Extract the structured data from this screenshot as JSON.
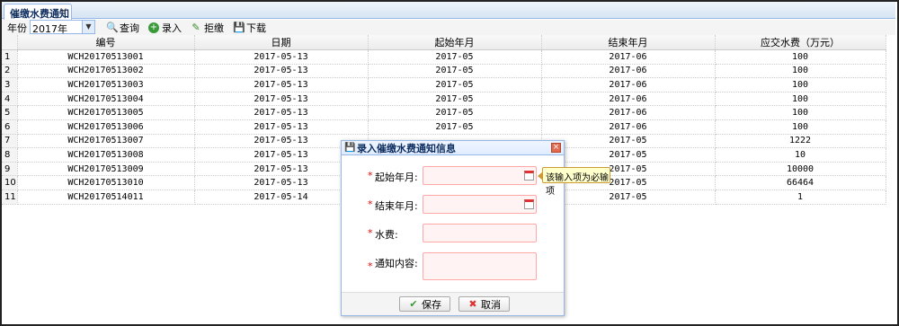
{
  "tab": {
    "title": "催缴水费通知",
    "close": "×"
  },
  "toolbar": {
    "year_label": "年份",
    "year_value": "2017年",
    "query_label": "查询",
    "add_label": "录入",
    "reject_label": "拒缴",
    "download_label": "下载"
  },
  "table": {
    "columns": [
      "编号",
      "日期",
      "起始年月",
      "结束年月",
      "应交水费（万元）"
    ],
    "rows": [
      {
        "n": "1",
        "id": "WCH20170513001",
        "date": "2017-05-13",
        "start": "2017-05",
        "end": "2017-06",
        "fee": "100"
      },
      {
        "n": "2",
        "id": "WCH20170513002",
        "date": "2017-05-13",
        "start": "2017-05",
        "end": "2017-06",
        "fee": "100"
      },
      {
        "n": "3",
        "id": "WCH20170513003",
        "date": "2017-05-13",
        "start": "2017-05",
        "end": "2017-06",
        "fee": "100"
      },
      {
        "n": "4",
        "id": "WCH20170513004",
        "date": "2017-05-13",
        "start": "2017-05",
        "end": "2017-06",
        "fee": "100"
      },
      {
        "n": "5",
        "id": "WCH20170513005",
        "date": "2017-05-13",
        "start": "2017-05",
        "end": "2017-06",
        "fee": "100"
      },
      {
        "n": "6",
        "id": "WCH20170513006",
        "date": "2017-05-13",
        "start": "2017-05",
        "end": "2017-06",
        "fee": "100"
      },
      {
        "n": "7",
        "id": "WCH20170513007",
        "date": "2017-05-13",
        "start": "",
        "end": "2017-05",
        "fee": "1222"
      },
      {
        "n": "8",
        "id": "WCH20170513008",
        "date": "2017-05-13",
        "start": "",
        "end": "2017-05",
        "fee": "10"
      },
      {
        "n": "9",
        "id": "WCH20170513009",
        "date": "2017-05-13",
        "start": "",
        "end": "2017-05",
        "fee": "10000"
      },
      {
        "n": "10",
        "id": "WCH20170513010",
        "date": "2017-05-13",
        "start": "",
        "end": "2017-05",
        "fee": "66464"
      },
      {
        "n": "11",
        "id": "WCH20170514011",
        "date": "2017-05-14",
        "start": "",
        "end": "2017-05",
        "fee": "1"
      }
    ]
  },
  "dialog": {
    "title": "录入催缴水费通知信息",
    "required_mark": "*",
    "start_label": "起始年月:",
    "end_label": "结束年月:",
    "fee_label": "水费:",
    "content_label": "通知内容:",
    "tooltip": "该输入项为必输项",
    "save_label": "保存",
    "cancel_label": "取消"
  },
  "colors": {
    "border": "#95b8e7",
    "required": "#ee0000",
    "invalid_bg": "#fff3f3",
    "tooltip_bg": "#ffffcc"
  }
}
